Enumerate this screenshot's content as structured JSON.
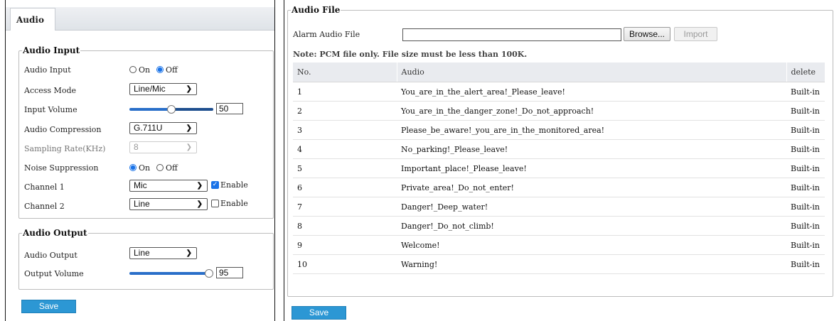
{
  "audio_tab": {
    "label": "Audio"
  },
  "audio_input": {
    "legend": "Audio Input",
    "audio_input": {
      "label": "Audio Input",
      "options": [
        "On",
        "Off"
      ],
      "selected": "Off"
    },
    "access_mode": {
      "label": "Access Mode",
      "value": "Line/Mic"
    },
    "input_volume": {
      "label": "Input Volume",
      "value": "50",
      "fraction": 0.5
    },
    "audio_compression": {
      "label": "Audio Compression",
      "value": "G.711U"
    },
    "sampling_rate": {
      "label": "Sampling Rate(KHz)",
      "value": "8",
      "disabled": true
    },
    "noise_suppression": {
      "label": "Noise Suppression",
      "options": [
        "On",
        "Off"
      ],
      "selected": "On"
    },
    "channel1": {
      "label": "Channel 1",
      "value": "Mic",
      "enable_label": "Enable",
      "enabled": true
    },
    "channel2": {
      "label": "Channel 2",
      "value": "Line",
      "enable_label": "Enable",
      "enabled": false
    }
  },
  "audio_output": {
    "legend": "Audio Output",
    "audio_output": {
      "label": "Audio Output",
      "value": "Line"
    },
    "output_volume": {
      "label": "Output Volume",
      "value": "95",
      "fraction": 0.95
    }
  },
  "left_save": "Save",
  "audio_file": {
    "legend": "Audio File",
    "alarm_label": "Alarm Audio File",
    "alarm_value": "",
    "browse": "Browse...",
    "import": "Import",
    "note": "Note: PCM file only. File size must be less than 100K.",
    "columns": [
      "No.",
      "Audio",
      "delete"
    ],
    "rows": [
      [
        "1",
        "You_are_in_the_alert_area!_Please_leave!",
        "Built-in"
      ],
      [
        "2",
        "You_are_in_the_danger_zone!_Do_not_approach!",
        "Built-in"
      ],
      [
        "3",
        "Please_be_aware!_you_are_in_the_monitored_area!",
        "Built-in"
      ],
      [
        "4",
        "No_parking!_Please_leave!",
        "Built-in"
      ],
      [
        "5",
        "Important_place!_Please_leave!",
        "Built-in"
      ],
      [
        "6",
        "Private_area!_Do_not_enter!",
        "Built-in"
      ],
      [
        "7",
        "Danger!_Deep_water!",
        "Built-in"
      ],
      [
        "8",
        "Danger!_Do_not_climb!",
        "Built-in"
      ],
      [
        "9",
        "Welcome!",
        "Built-in"
      ],
      [
        "10",
        "Warning!",
        "Built-in"
      ]
    ]
  },
  "right_save": "Save",
  "colors": {
    "accent": "#1a73e8",
    "save_button": "#2c97d4",
    "slider_fill": "#2a6fc9"
  }
}
